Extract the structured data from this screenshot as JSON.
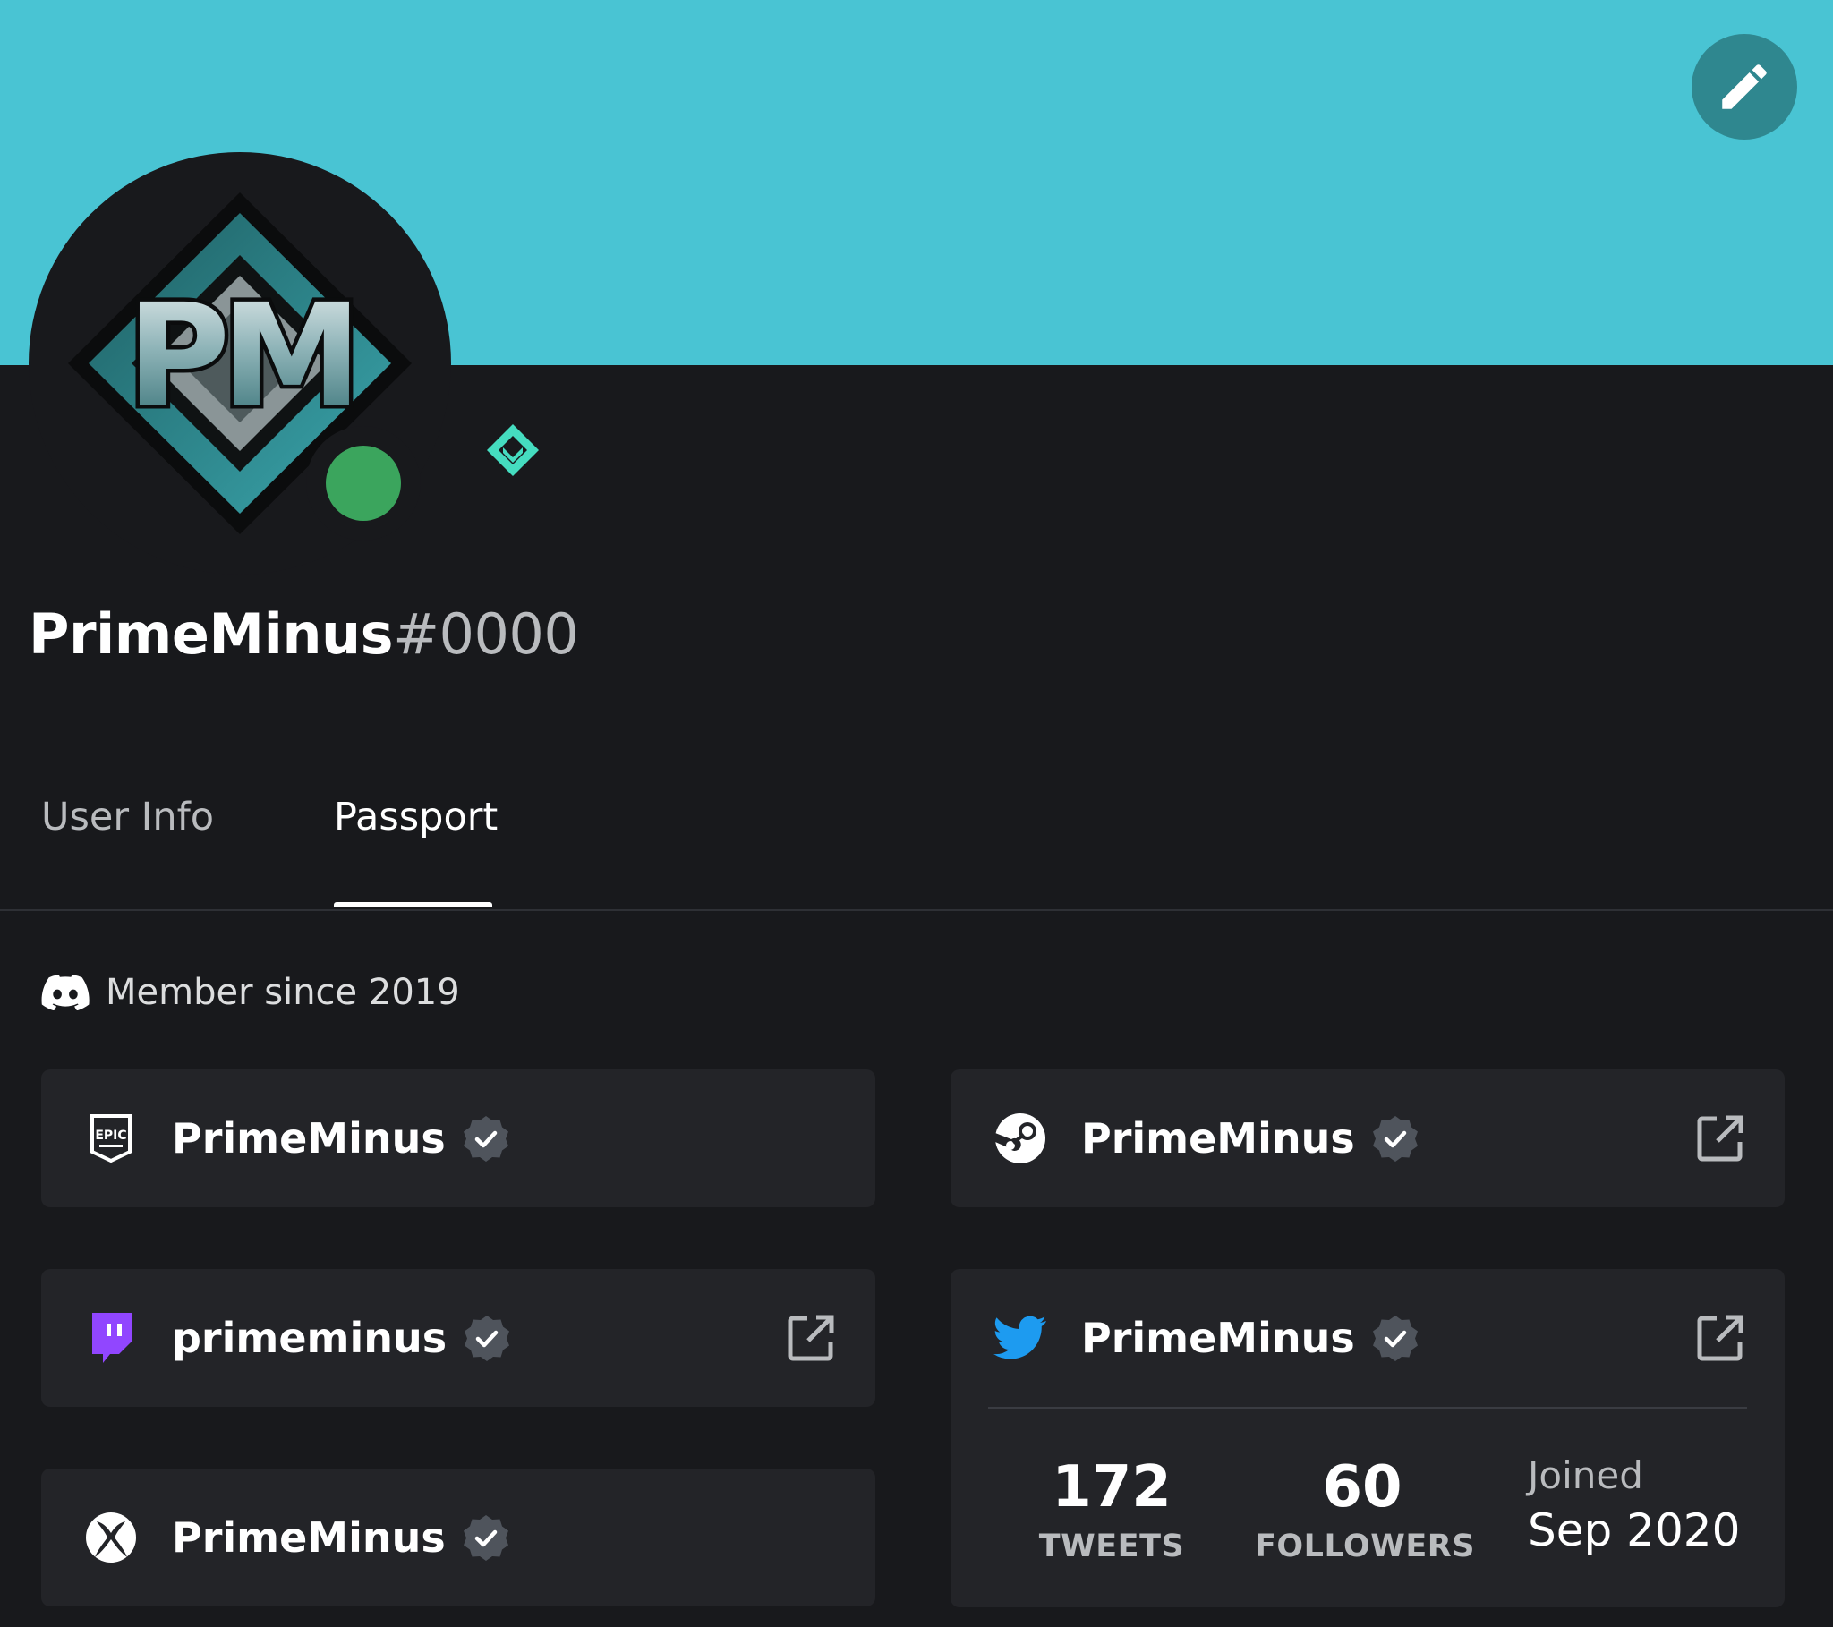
{
  "profile": {
    "username": "PrimeMinus",
    "discriminator": "#0000",
    "avatar_initials": "PM",
    "status": "online"
  },
  "tabs": [
    {
      "label": "User Info",
      "active": false
    },
    {
      "label": "Passport",
      "active": true
    }
  ],
  "passport": {
    "member_since": "Member since 2019"
  },
  "accounts": {
    "epic": {
      "name": "PrimeMinus",
      "icon": "epic-games-icon"
    },
    "steam": {
      "name": "PrimeMinus",
      "icon": "steam-icon"
    },
    "twitch": {
      "name": "primeminus",
      "icon": "twitch-icon"
    },
    "xbox": {
      "name": "PrimeMinus",
      "icon": "xbox-icon"
    },
    "twitter": {
      "name": "PrimeMinus",
      "icon": "twitter-icon",
      "tweets": "172",
      "tweets_label": "TWEETS",
      "followers": "60",
      "followers_label": "FOLLOWERS",
      "joined_label": "Joined",
      "joined_date": "Sep 2020"
    }
  },
  "colors": {
    "banner": "#49c4d3",
    "background": "#18191c",
    "card": "#232428",
    "online": "#3ba55d",
    "twitch": "#9146ff",
    "twitter": "#1d9bf0"
  }
}
